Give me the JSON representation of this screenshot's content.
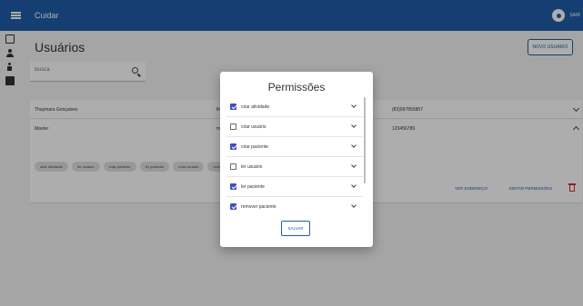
{
  "app": {
    "title": "Cuidar",
    "logout_label": "SAIR"
  },
  "page": {
    "title": "Usuários",
    "new_user_label": "NOVO USUÁRIO"
  },
  "search": {
    "placeholder": "Busca"
  },
  "users": [
    {
      "name": "Thaymara Gonçalves",
      "col2": "th",
      "phone": "(83)997859857",
      "expanded": false
    },
    {
      "name": "Master",
      "col2": "m",
      "phone": "123456789",
      "expanded": true,
      "chips": [
        "criar atividade",
        "ler usuário",
        "criar paciente",
        "ler paciente",
        "criar usuário",
        "remover"
      ]
    }
  ],
  "row_actions": {
    "address": "VER ENDEREÇO",
    "permissions": "EDITAR PERMISSÕES"
  },
  "dialog": {
    "title": "Permissões",
    "items": [
      {
        "label": "criar atividade",
        "checked": true
      },
      {
        "label": "criar usuário",
        "checked": false
      },
      {
        "label": "criar paciente",
        "checked": true
      },
      {
        "label": "ler usuário",
        "checked": false
      },
      {
        "label": "ler paciente",
        "checked": true
      },
      {
        "label": "remover paciente",
        "checked": true
      }
    ],
    "save_label": "SALVAR"
  },
  "colors": {
    "primary": "#1f5ea8",
    "checkbox": "#3f51b5",
    "danger": "#d32f2f"
  }
}
